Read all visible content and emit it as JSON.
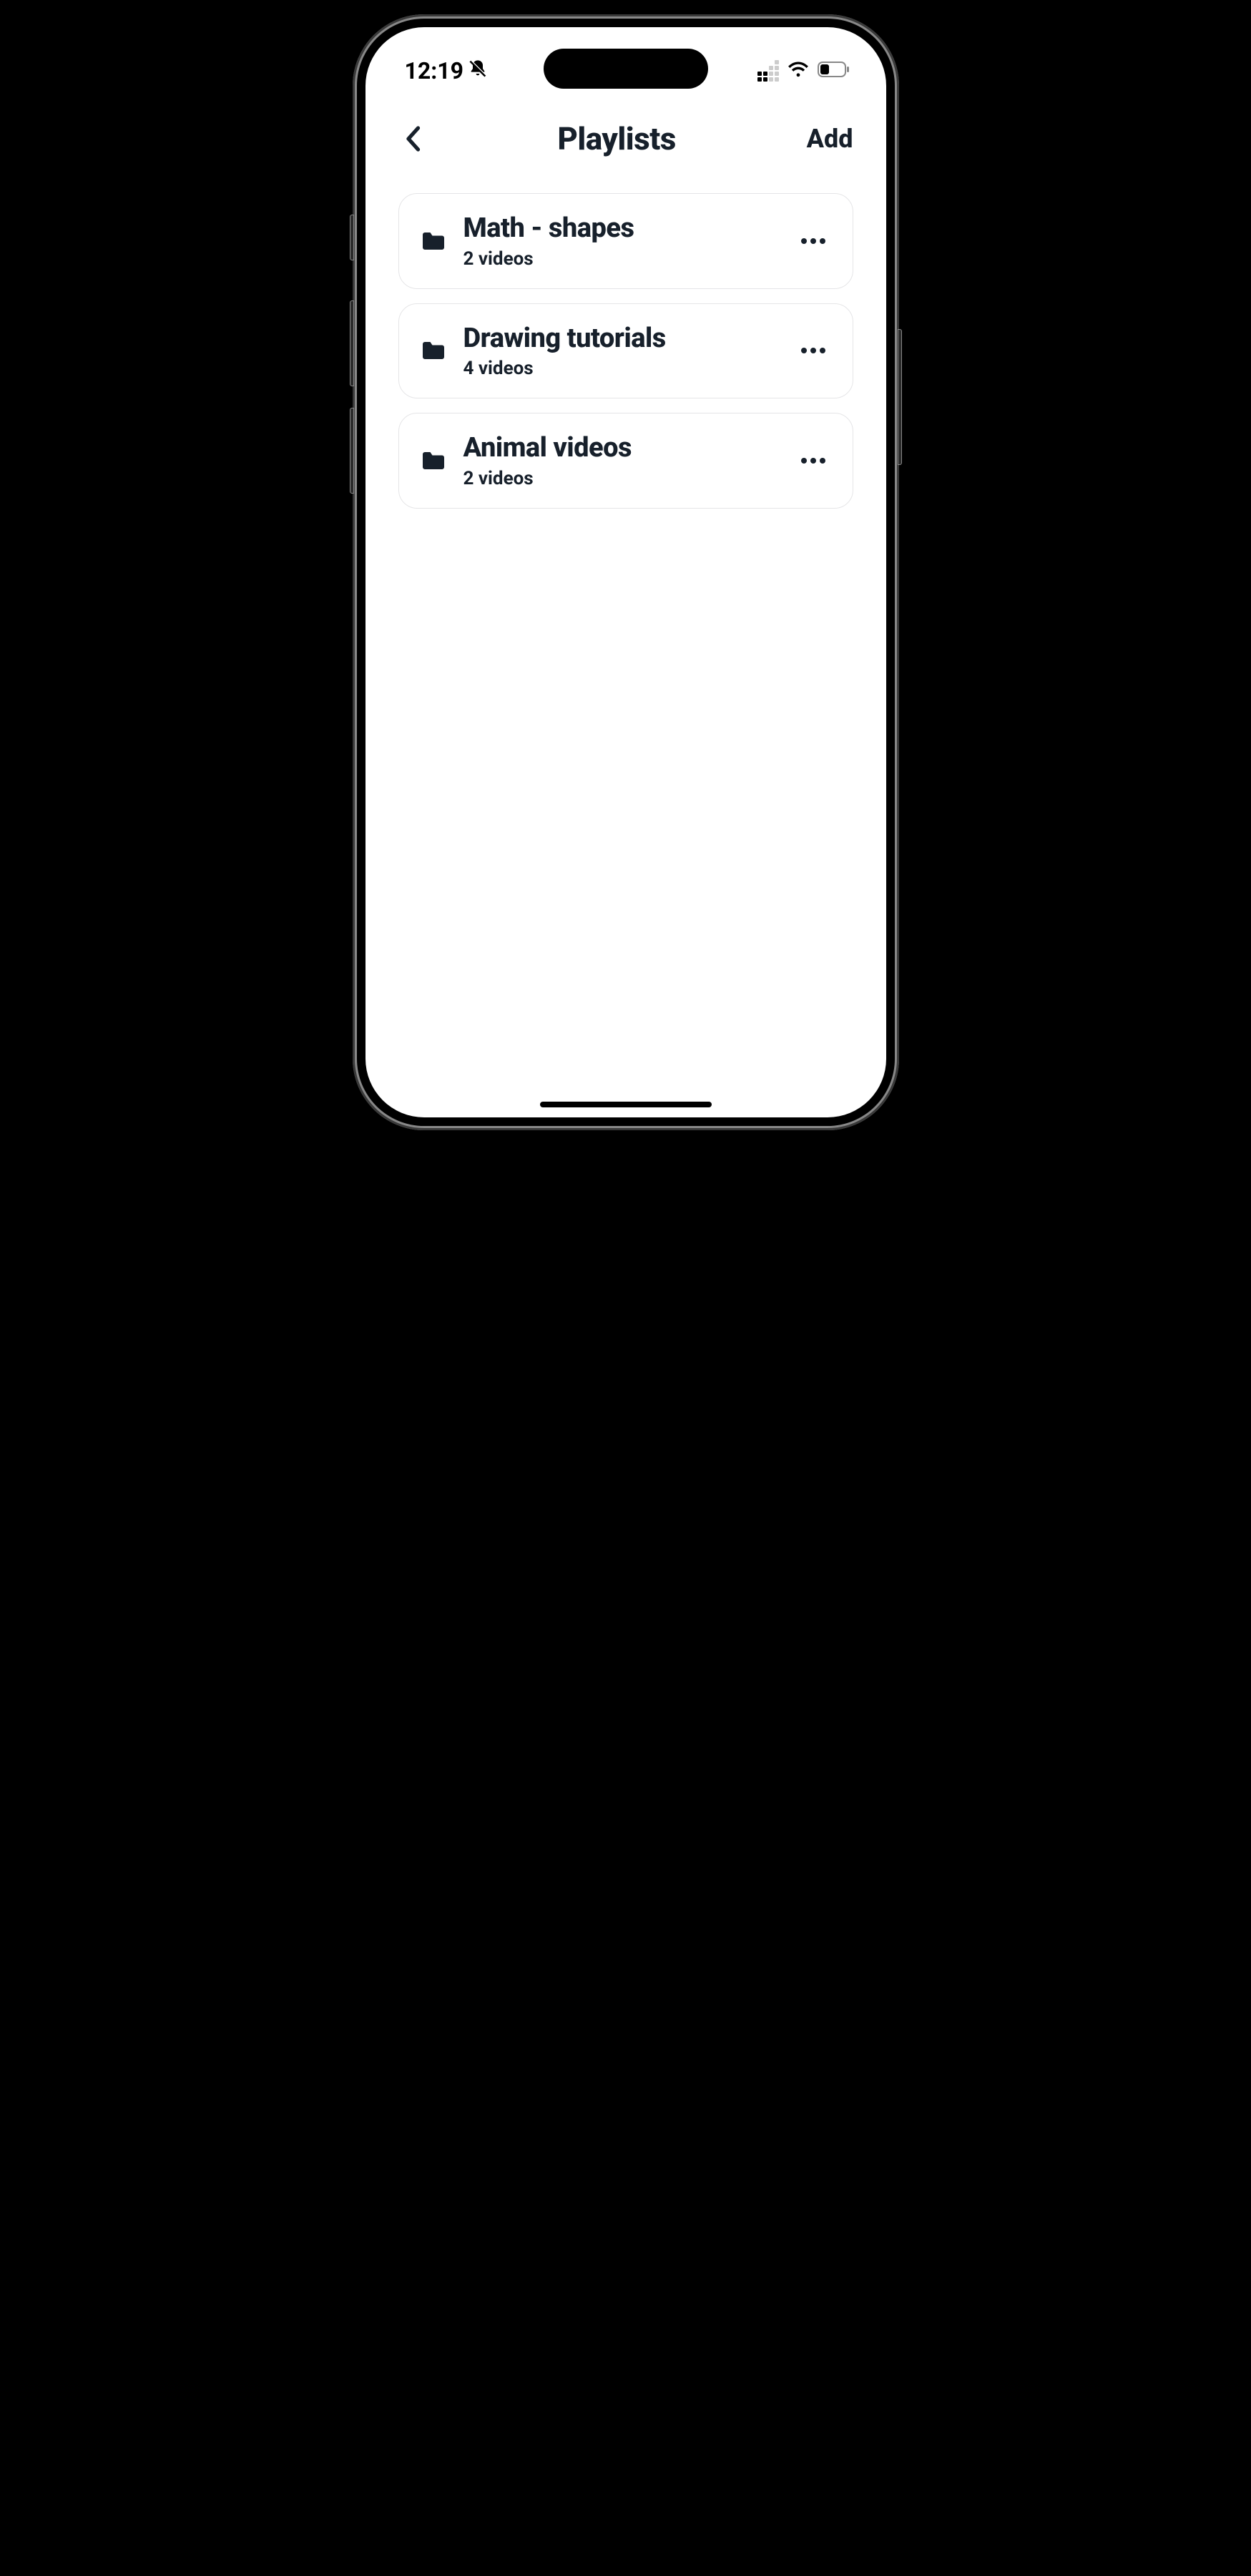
{
  "status": {
    "time": "12:19"
  },
  "header": {
    "title": "Playlists",
    "add_label": "Add"
  },
  "playlists": [
    {
      "title": "Math - shapes",
      "subtitle": "2 videos"
    },
    {
      "title": "Drawing tutorials",
      "subtitle": "4 videos"
    },
    {
      "title": "Animal videos",
      "subtitle": "2 videos"
    }
  ]
}
